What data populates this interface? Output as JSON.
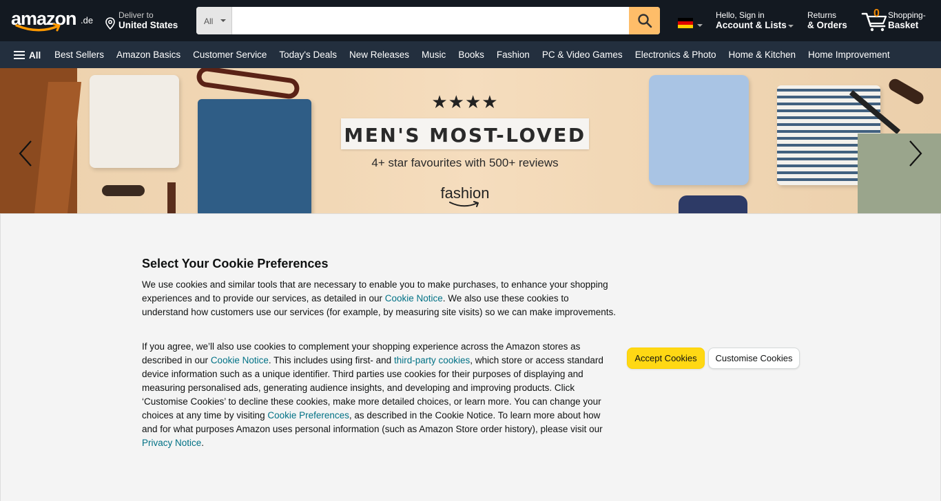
{
  "header": {
    "logo_text": "amazon",
    "logo_tld": ".de",
    "deliver_line1": "Deliver to",
    "deliver_line2": "United States",
    "search_category": "All",
    "search_placeholder": "",
    "account_line1": "Hello, Sign in",
    "account_line2": "Account & Lists",
    "returns_line1": "Returns",
    "returns_line2": "& Orders",
    "cart_count": "0",
    "cart_line1": "Shopping-",
    "cart_line2": "Basket"
  },
  "subnav": {
    "all_label": "All",
    "links": [
      "Best Sellers",
      "Amazon Basics",
      "Customer Service",
      "Today's Deals",
      "New Releases",
      "Music",
      "Books",
      "Fashion",
      "PC & Video Games",
      "Electronics & Photo",
      "Home & Kitchen",
      "Home Improvement"
    ]
  },
  "hero": {
    "stars": "★★★★",
    "headline": "MEN'S MOST-LOVED",
    "subline": "4+ star favourites with 500+ reviews",
    "brand": "fashion"
  },
  "cookie": {
    "title": "Select Your Cookie Preferences",
    "p1_a": "We use cookies and similar tools that are necessary to enable you to make purchases, to enhance your shopping experiences and to provide our services, as detailed in our ",
    "p1_link": "Cookie Notice",
    "p1_b": ". We also use these cookies to understand how customers use our services (for example, by measuring site visits) so we can make improvements.",
    "p2_a": "If you agree, we’ll also use cookies to complement your shopping experience across the Amazon stores as described in our ",
    "p2_link1": "Cookie Notice",
    "p2_b": ". This includes using first- and ",
    "p2_link2": "third-party cookies",
    "p2_c": ", which store or access standard device information such as a unique identifier. Third parties use cookies for their purposes of displaying and measuring personalised ads, generating audience insights, and developing and improving products. Click ‘Customise Cookies’ to decline these cookies, make more detailed choices, or learn more. You can change your choices at any time by visiting ",
    "p2_link3": "Cookie Preferences",
    "p2_d": ", as described in the Cookie Notice. To learn more about how and for what purposes Amazon uses personal information (such as Amazon Store order history), please visit our ",
    "p2_link4": "Privacy Notice",
    "p2_e": ".",
    "accept_label": "Accept Cookies",
    "customise_label": "Customise Cookies"
  },
  "colors": {
    "nav_top": "#131921",
    "nav_sub": "#232f3e",
    "search_button": "#febd69",
    "accept_button": "#ffd814",
    "link": "#007185",
    "cart_count": "#f08804"
  },
  "icons": [
    "location-pin-icon",
    "search-icon",
    "germany-flag-icon",
    "cart-icon",
    "hamburger-icon",
    "chevron-left-icon",
    "chevron-right-icon"
  ]
}
